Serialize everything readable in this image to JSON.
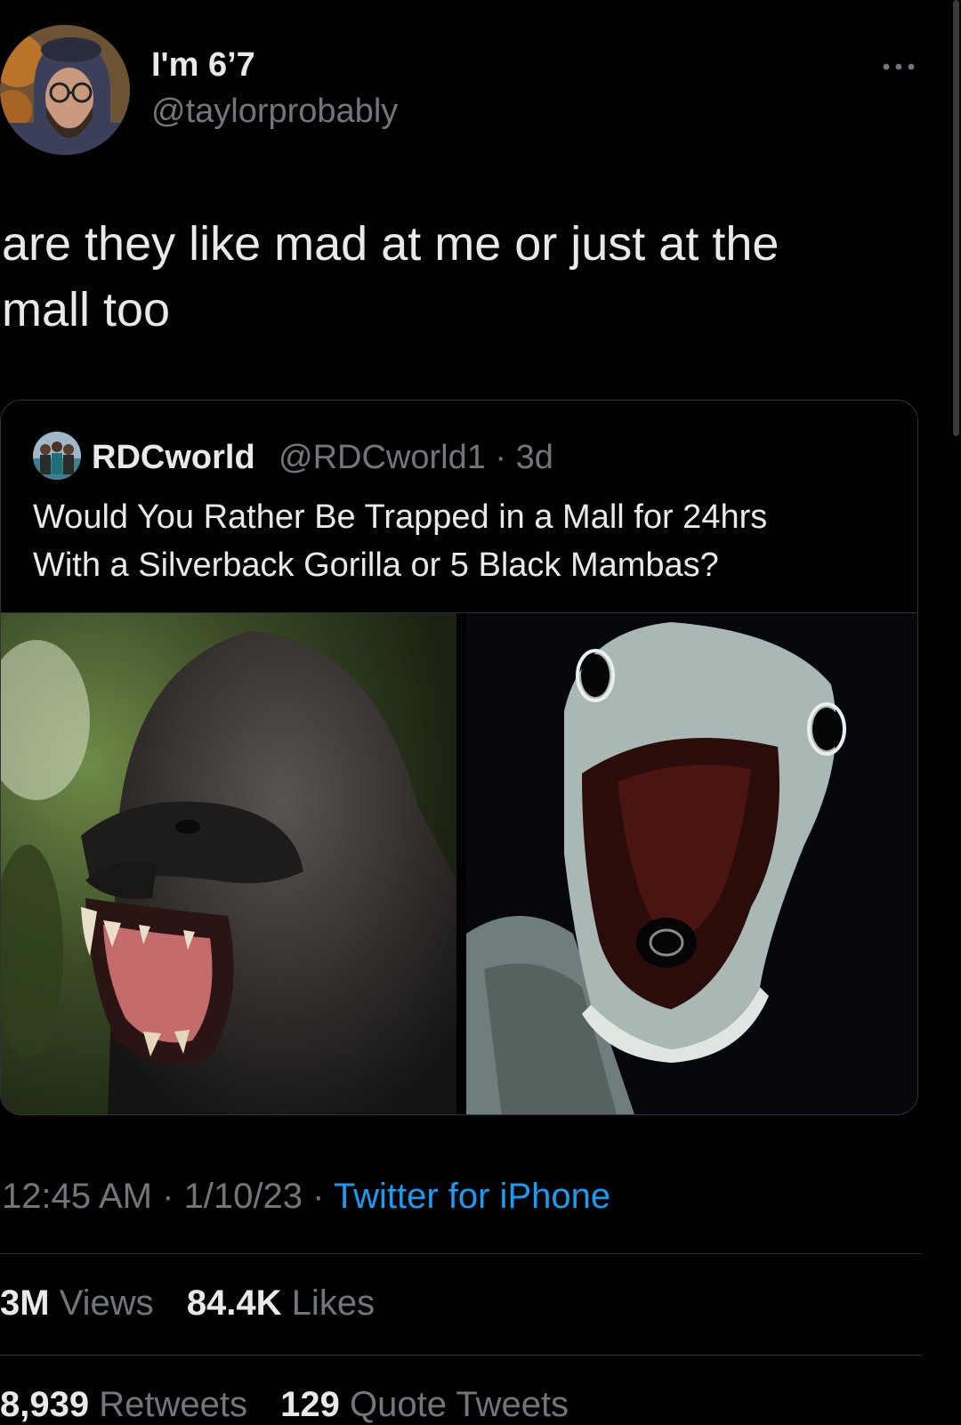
{
  "author": {
    "display_name": "I'm 6’7",
    "handle": "@taylorprobably"
  },
  "tweet": {
    "text_line1": "are they like mad at me or just at the",
    "text_line2": "mall too",
    "time": "12:45 AM",
    "date": "1/10/23",
    "separator": " · ",
    "source": "Twitter for iPhone"
  },
  "quote": {
    "display_name": "RDCworld",
    "handle_time": "@RDCworld1 · 3d",
    "text_line1": "Would You Rather Be Trapped in a Mall for 24hrs",
    "text_line2": "With a Silverback Gorilla or 5 Black Mambas?"
  },
  "stats": {
    "views_value": "3M",
    "views_label": "Views",
    "likes_value": "84.4K",
    "likes_label": "Likes",
    "retweets_value": "8,939",
    "retweets_label": "Retweets",
    "quotes_value": "129",
    "quotes_label": "Quote Tweets"
  },
  "icons": {
    "more": "more-horizontal-icon"
  },
  "colors": {
    "background": "#000000",
    "text": "#e7e9ea",
    "muted": "#71767b",
    "link": "#1d9bf0",
    "border": "#2f3336"
  }
}
